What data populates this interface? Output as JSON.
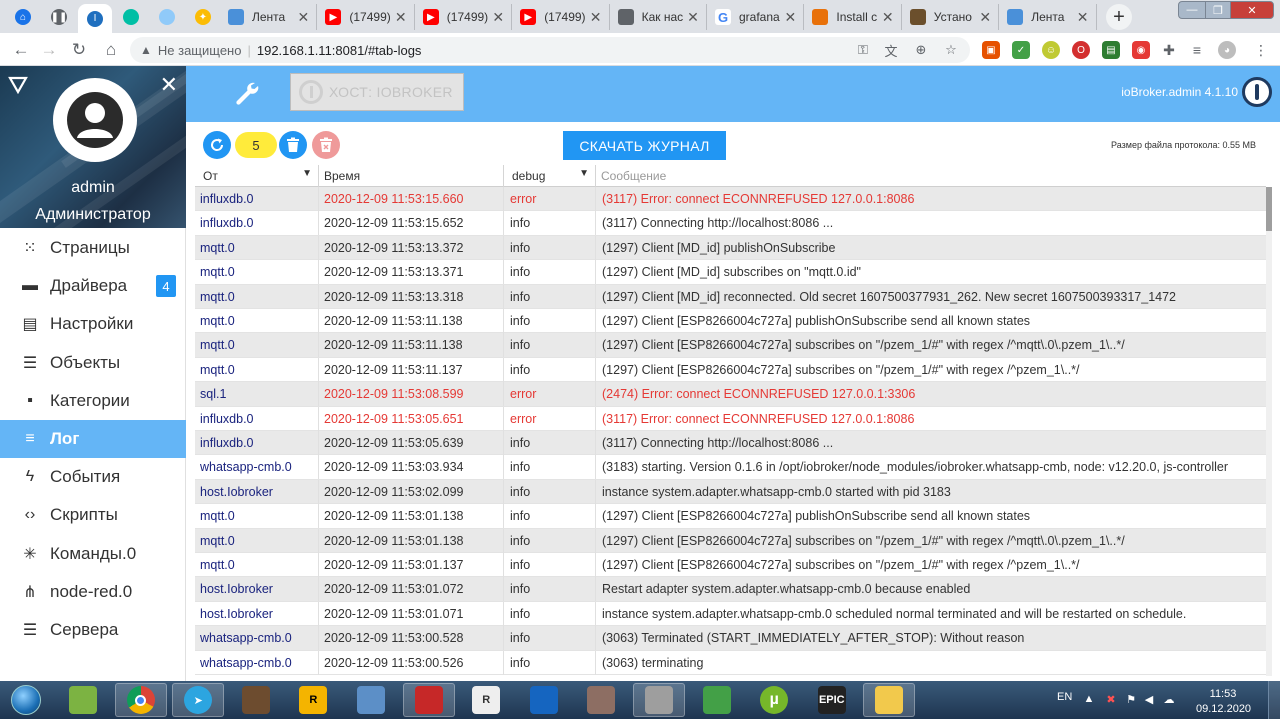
{
  "browser": {
    "tabs": [
      {
        "title": "Лента",
        "icon": "page-icon",
        "color": "#4a90d9"
      },
      {
        "title": "(17499)",
        "icon": "youtube-icon",
        "color": "#ff0000"
      },
      {
        "title": "(17499)",
        "icon": "youtube-icon",
        "color": "#ff0000"
      },
      {
        "title": "(17499)",
        "icon": "youtube-icon",
        "color": "#ff0000"
      },
      {
        "title": "Как нас",
        "icon": "globe-icon",
        "color": "#5f6368"
      },
      {
        "title": "grafana",
        "icon": "google-icon",
        "color": "#4285f4"
      },
      {
        "title": "Install c",
        "icon": "gear-icon",
        "color": "#e8710a"
      },
      {
        "title": "Устано",
        "icon": "page-icon",
        "color": "#6b4f2c"
      },
      {
        "title": "Лента",
        "icon": "page-icon",
        "color": "#4a90d9"
      }
    ],
    "address": {
      "security_text": "Не защищено",
      "url": "192.168.1.11:8081/#tab-logs"
    }
  },
  "header": {
    "host_label": "ХОСТ: IOBROKER",
    "version": "ioBroker.admin 4.1.10"
  },
  "sidebar": {
    "username": "admin",
    "role": "Администратор",
    "items": [
      {
        "label": "Страницы",
        "icon": "apps-grid-icon"
      },
      {
        "label": "Драйвера",
        "icon": "store-icon",
        "badge": "4"
      },
      {
        "label": "Настройки",
        "icon": "settings-panel-icon"
      },
      {
        "label": "Объекты",
        "icon": "list-icon"
      },
      {
        "label": "Категории",
        "icon": "categories-icon"
      },
      {
        "label": "Лог",
        "icon": "menu-lines-icon",
        "active": true
      },
      {
        "label": "События",
        "icon": "lightning-icon"
      },
      {
        "label": "Скрипты",
        "icon": "code-icon"
      },
      {
        "label": "Команды.0",
        "icon": "asterisk-icon"
      },
      {
        "label": "node-red.0",
        "icon": "flow-icon"
      },
      {
        "label": "Сервера",
        "icon": "servers-icon"
      }
    ]
  },
  "toolbar": {
    "count": "5",
    "download_label": "СКАЧАТЬ ЖУРНАЛ",
    "file_size": "Размер файла протокола: 0.55 MB"
  },
  "table": {
    "headers": {
      "from": "От",
      "time": "Время",
      "severity": "debug",
      "message": "Сообщение"
    },
    "rows": [
      {
        "from": "influxdb.0",
        "time": "2020-12-09 11:53:15.660",
        "severity": "error",
        "message": "(3117) Error: connect ECONNREFUSED 127.0.0.1:8086"
      },
      {
        "from": "influxdb.0",
        "time": "2020-12-09 11:53:15.652",
        "severity": "info",
        "message": "(3117) Connecting http://localhost:8086 ..."
      },
      {
        "from": "mqtt.0",
        "time": "2020-12-09 11:53:13.372",
        "severity": "info",
        "message": "(1297) Client [MD_id] publishOnSubscribe"
      },
      {
        "from": "mqtt.0",
        "time": "2020-12-09 11:53:13.371",
        "severity": "info",
        "message": "(1297) Client [MD_id] subscribes on \"mqtt.0.id\""
      },
      {
        "from": "mqtt.0",
        "time": "2020-12-09 11:53:13.318",
        "severity": "info",
        "message": "(1297) Client [MD_id] reconnected. Old secret 1607500377931_262. New secret 1607500393317_1472"
      },
      {
        "from": "mqtt.0",
        "time": "2020-12-09 11:53:11.138",
        "severity": "info",
        "message": "(1297) Client [ESP8266004c727a] publishOnSubscribe send all known states"
      },
      {
        "from": "mqtt.0",
        "time": "2020-12-09 11:53:11.138",
        "severity": "info",
        "message": "(1297) Client [ESP8266004c727a] subscribes on \"/pzem_1/#\" with regex /^mqtt\\.0\\.pzem_1\\..*/"
      },
      {
        "from": "mqtt.0",
        "time": "2020-12-09 11:53:11.137",
        "severity": "info",
        "message": "(1297) Client [ESP8266004c727a] subscribes on \"/pzem_1/#\" with regex /^pzem_1\\..*/"
      },
      {
        "from": "sql.1",
        "time": "2020-12-09 11:53:08.599",
        "severity": "error",
        "message": "(2474) Error: connect ECONNREFUSED 127.0.0.1:3306"
      },
      {
        "from": "influxdb.0",
        "time": "2020-12-09 11:53:05.651",
        "severity": "error",
        "message": "(3117) Error: connect ECONNREFUSED 127.0.0.1:8086"
      },
      {
        "from": "influxdb.0",
        "time": "2020-12-09 11:53:05.639",
        "severity": "info",
        "message": "(3117) Connecting http://localhost:8086 ..."
      },
      {
        "from": "whatsapp-cmb.0",
        "time": "2020-12-09 11:53:03.934",
        "severity": "info",
        "message": "(3183) starting. Version 0.1.6 in /opt/iobroker/node_modules/iobroker.whatsapp-cmb, node: v12.20.0, js-controller"
      },
      {
        "from": "host.Iobroker",
        "time": "2020-12-09 11:53:02.099",
        "severity": "info",
        "message": "instance system.adapter.whatsapp-cmb.0 started with pid 3183"
      },
      {
        "from": "mqtt.0",
        "time": "2020-12-09 11:53:01.138",
        "severity": "info",
        "message": "(1297) Client [ESP8266004c727a] publishOnSubscribe send all known states"
      },
      {
        "from": "mqtt.0",
        "time": "2020-12-09 11:53:01.138",
        "severity": "info",
        "message": "(1297) Client [ESP8266004c727a] subscribes on \"/pzem_1/#\" with regex /^mqtt\\.0\\.pzem_1\\..*/"
      },
      {
        "from": "mqtt.0",
        "time": "2020-12-09 11:53:01.137",
        "severity": "info",
        "message": "(1297) Client [ESP8266004c727a] subscribes on \"/pzem_1/#\" with regex /^pzem_1\\..*/"
      },
      {
        "from": "host.Iobroker",
        "time": "2020-12-09 11:53:01.072",
        "severity": "info",
        "message": "Restart adapter system.adapter.whatsapp-cmb.0 because enabled"
      },
      {
        "from": "host.Iobroker",
        "time": "2020-12-09 11:53:01.071",
        "severity": "info",
        "message": "instance system.adapter.whatsapp-cmb.0 scheduled normal terminated and will be restarted on schedule."
      },
      {
        "from": "whatsapp-cmb.0",
        "time": "2020-12-09 11:53:00.528",
        "severity": "info",
        "message": "(3063) Terminated (START_IMMEDIATELY_AFTER_STOP): Without reason"
      },
      {
        "from": "whatsapp-cmb.0",
        "time": "2020-12-09 11:53:00.526",
        "severity": "info",
        "message": "(3063) terminating"
      }
    ]
  },
  "taskbar": {
    "apps": [
      {
        "icon": "cube-app-icon",
        "color": "#7cb342",
        "open": false
      },
      {
        "icon": "chrome-icon",
        "color": "#db4437",
        "open": true
      },
      {
        "icon": "telegram-icon",
        "color": "#2ca5e0",
        "open": true
      },
      {
        "icon": "minecraft-icon",
        "color": "#6d4c2f",
        "open": false
      },
      {
        "icon": "rockstar-icon",
        "color": "#f4b400",
        "open": false
      },
      {
        "icon": "network-tool-icon",
        "color": "#5c8fc7",
        "open": false
      },
      {
        "icon": "putty-icon",
        "color": "#c62828",
        "open": true
      },
      {
        "icon": "r-app-icon",
        "color": "#eeeeee",
        "open": false
      },
      {
        "icon": "anydesk-icon",
        "color": "#1565c0",
        "open": false
      },
      {
        "icon": "network-share-icon",
        "color": "#8d6e63",
        "open": false
      },
      {
        "icon": "vpn-icon",
        "color": "#9e9e9e",
        "open": true
      },
      {
        "icon": "utorrent-green-icon",
        "color": "#43a047",
        "open": false
      },
      {
        "icon": "utorrent-icon",
        "color": "#76b72a",
        "open": false
      },
      {
        "icon": "epic-games-icon",
        "color": "#222222",
        "open": false,
        "text": "EPIC"
      },
      {
        "icon": "file-explorer-icon",
        "color": "#f2c94c",
        "open": true
      }
    ],
    "language": "EN",
    "time": "11:53",
    "date": "09.12.2020"
  }
}
